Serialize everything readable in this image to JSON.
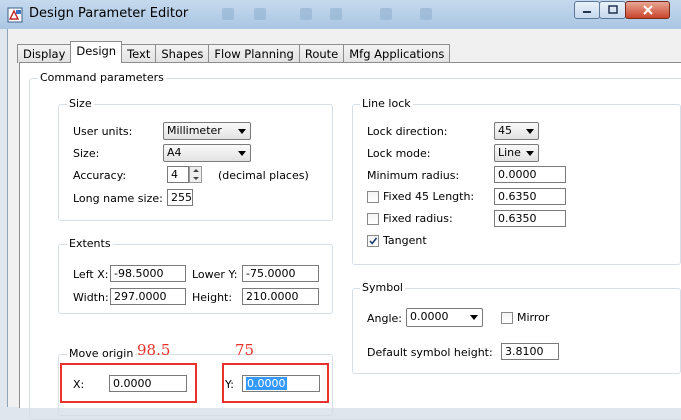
{
  "window": {
    "title": "Design Parameter Editor"
  },
  "tabs": [
    "Display",
    "Design",
    "Text",
    "Shapes",
    "Flow Planning",
    "Route",
    "Mfg Applications"
  ],
  "command_parameters": {
    "label": "Command parameters"
  },
  "size": {
    "label": "Size",
    "user_units_label": "User units:",
    "user_units_value": "Millimeter",
    "size_label": "Size:",
    "size_value": "A4",
    "accuracy_label": "Accuracy:",
    "accuracy_value": "4",
    "accuracy_hint": "(decimal places)",
    "long_name_label": "Long name size:",
    "long_name_value": "255"
  },
  "extents": {
    "label": "Extents",
    "left_x_label": "Left X:",
    "left_x_value": "-98.5000",
    "lower_y_label": "Lower Y:",
    "lower_y_value": "-75.0000",
    "width_label": "Width:",
    "width_value": "297.0000",
    "height_label": "Height:",
    "height_value": "210.0000"
  },
  "move_origin": {
    "label": "Move origin",
    "x_label": "X:",
    "x_value": "0.0000",
    "y_label": "Y:",
    "y_value": "0.0000"
  },
  "annotations": {
    "x_note": "98.5",
    "y_note": "75",
    "color": "#e8322b"
  },
  "line_lock": {
    "label": "Line lock",
    "lock_direction_label": "Lock direction:",
    "lock_direction_value": "45",
    "lock_mode_label": "Lock mode:",
    "lock_mode_value": "Line",
    "min_radius_label": "Minimum radius:",
    "min_radius_value": "0.0000",
    "fixed45_label": "Fixed 45 Length:",
    "fixed45_checked": false,
    "fixed45_value": "0.6350",
    "fixed_radius_label": "Fixed radius:",
    "fixed_radius_checked": false,
    "fixed_radius_value": "0.6350",
    "tangent_label": "Tangent",
    "tangent_checked": true
  },
  "symbol": {
    "label": "Symbol",
    "angle_label": "Angle:",
    "angle_value": "0.0000",
    "mirror_label": "Mirror",
    "mirror_checked": false,
    "default_height_label": "Default symbol height:",
    "default_height_value": "3.8100"
  }
}
